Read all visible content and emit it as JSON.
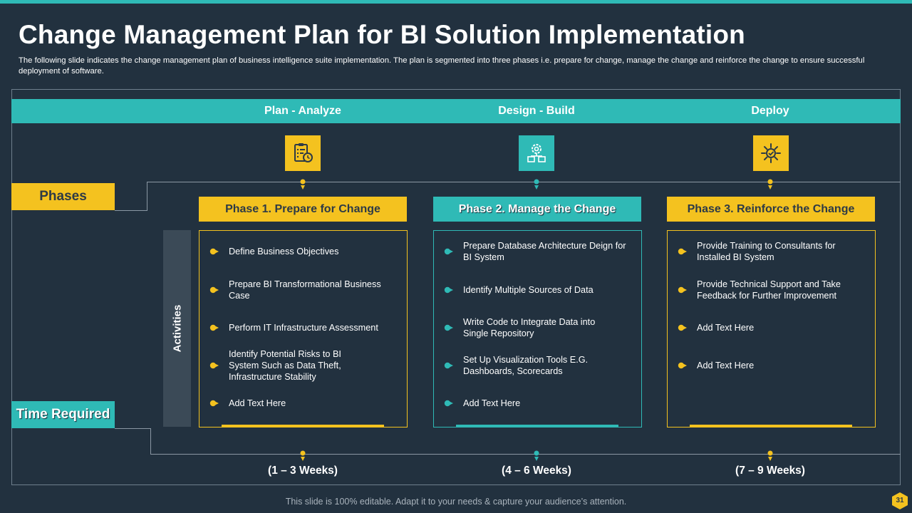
{
  "title": "Change Management Plan for BI Solution Implementation",
  "subtitle": "The following slide indicates the change management plan of business intelligence suite implementation. The plan is segmented into three phases i.e. prepare for change, manage the change and reinforce the change to ensure successful deployment of software.",
  "stages": [
    "Plan - Analyze",
    "Design - Build",
    "Deploy"
  ],
  "icons": [
    "clipboard-checklist-icon",
    "gear-network-icon",
    "gear-check-icon"
  ],
  "row_labels": {
    "phases": "Phases",
    "time_required": "Time Required",
    "activities": "Activities"
  },
  "phases": [
    {
      "name": "Phase 1. Prepare for Change",
      "activities": [
        "Define Business Objectives",
        "Prepare BI Transformational Business Case",
        "Perform IT Infrastructure Assessment",
        "Identify Potential Risks to BI System Such as Data Theft, Infrastructure Stability",
        "Add Text Here"
      ],
      "time": "(1 – 3 Weeks)"
    },
    {
      "name": "Phase 2. Manage the Change",
      "activities": [
        "Prepare Database Architecture Deign for BI System",
        "Identify Multiple Sources of Data",
        "Write Code to Integrate Data into Single Repository",
        "Set Up Visualization Tools E.G. Dashboards, Scorecards",
        "Add Text Here"
      ],
      "time": "(4 – 6 Weeks)"
    },
    {
      "name": "Phase 3. Reinforce the Change",
      "activities": [
        "Provide Training to Consultants for Installed BI System",
        "Provide Technical Support and Take Feedback for Further Improvement",
        "Add Text Here",
        "Add Text Here"
      ],
      "time": "(7 – 9 Weeks)"
    }
  ],
  "footer": "This slide is 100% editable. Adapt it to your needs & capture your audience’s attention.",
  "page_number": "31",
  "colors": {
    "background": "#22313f",
    "accent_yellow": "#f4c21f",
    "accent_teal": "#2fbab6",
    "panel": "#3b4a57"
  }
}
